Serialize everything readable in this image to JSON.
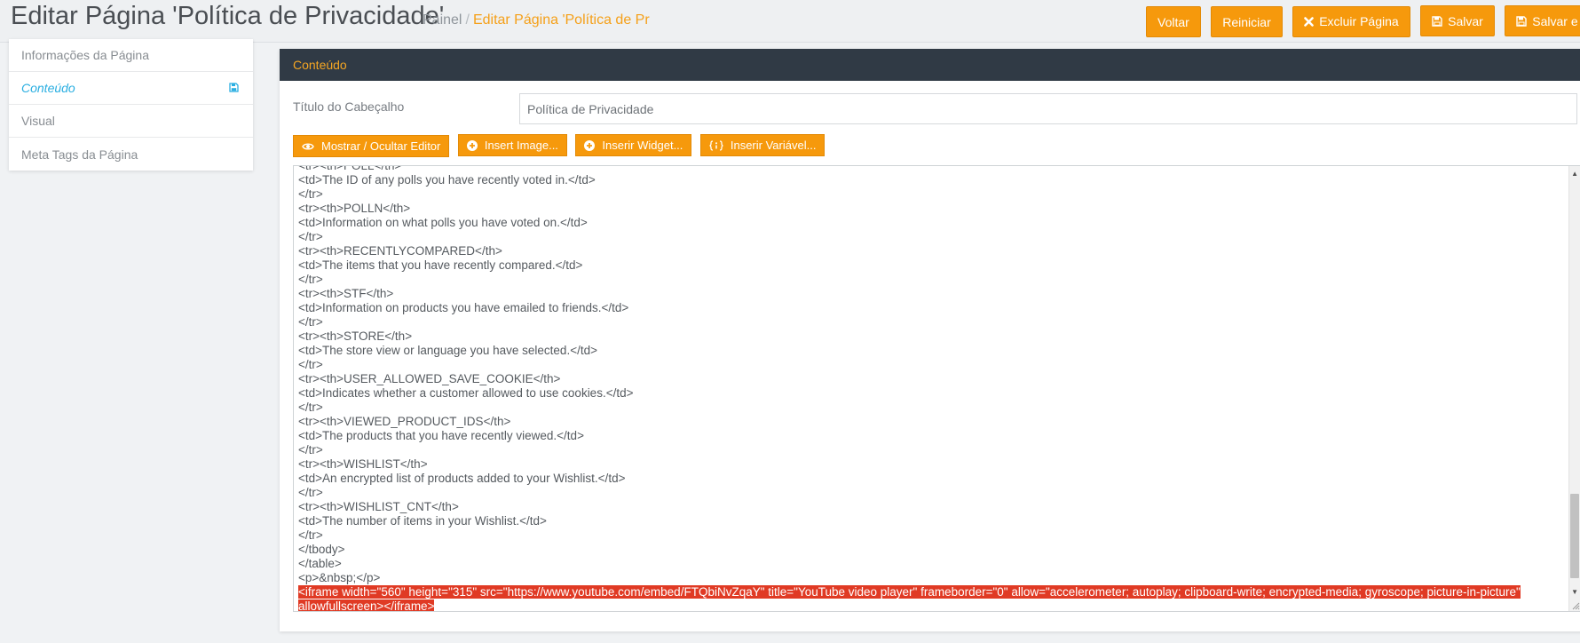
{
  "header": {
    "title": "Editar Página 'Política de Privacidade'",
    "breadcrumb_home": "Painel",
    "breadcrumb_separator": "/",
    "breadcrumb_current": "Editar Página 'Política de Priv",
    "actions": {
      "back": "Voltar",
      "reset": "Reiniciar",
      "delete": "Excluir Página",
      "save": "Salvar",
      "save_continue": "Salvar e Contin"
    }
  },
  "sidebar": {
    "items": [
      {
        "label": "Informações da Página"
      },
      {
        "label": "Conteúdo",
        "active": true,
        "icon": "save-icon"
      },
      {
        "label": "Visual"
      },
      {
        "label": "Meta Tags da Página"
      }
    ]
  },
  "panel": {
    "title": "Conteúdo",
    "heading_label": "Título do Cabeçalho",
    "heading_value": "Política de Privacidade",
    "toolbar": {
      "toggle_editor": "Mostrar / Ocultar Editor",
      "insert_image": "Insert Image...",
      "insert_widget": "Inserir Widget...",
      "insert_variable": "Inserir Variável..."
    }
  },
  "editor": {
    "lines": [
      "<tr><th>POLL</th>",
      "<td>The ID of any polls you have recently voted in.</td>",
      "</tr>",
      "<tr><th>POLLN</th>",
      "<td>Information on what polls you have voted on.</td>",
      "</tr>",
      "<tr><th>RECENTLYCOMPARED</th>",
      "<td>The items that you have recently compared.</td>",
      "</tr>",
      "<tr><th>STF</th>",
      "<td>Information on products you have emailed to friends.</td>",
      "</tr>",
      "<tr><th>STORE</th>",
      "<td>The store view or language you have selected.</td>",
      "</tr>",
      "<tr><th>USER_ALLOWED_SAVE_COOKIE</th>",
      "<td>Indicates whether a customer allowed to use cookies.</td>",
      "</tr>",
      "<tr><th>VIEWED_PRODUCT_IDS</th>",
      "<td>The products that you have recently viewed.</td>",
      "</tr>",
      "<tr><th>WISHLIST</th>",
      "<td>An encrypted list of products added to your Wishlist.</td>",
      "</tr>",
      "<tr><th>WISHLIST_CNT</th>",
      "<td>The number of items in your Wishlist.</td>",
      "</tr>",
      "</tbody>",
      "</table>",
      "<p>&nbsp;</p>"
    ],
    "selected_lines": [
      "<iframe width=\"560\" height=\"315\" src=\"https://www.youtube.com/embed/FTQbiNvZqaY\" title=\"YouTube video player\" frameborder=\"0\" allow=\"accelerometer; autoplay; clipboard-write; encrypted-media; gyroscope; picture-in-picture\"",
      "allowfullscreen></iframe>"
    ],
    "scroll_position": 0.85,
    "selection_color": "#e03a24"
  },
  "colors": {
    "accent": "#f6990c",
    "panel_header": "#303a45",
    "panel_title": "#f5a623",
    "active_link": "#29aee1"
  }
}
